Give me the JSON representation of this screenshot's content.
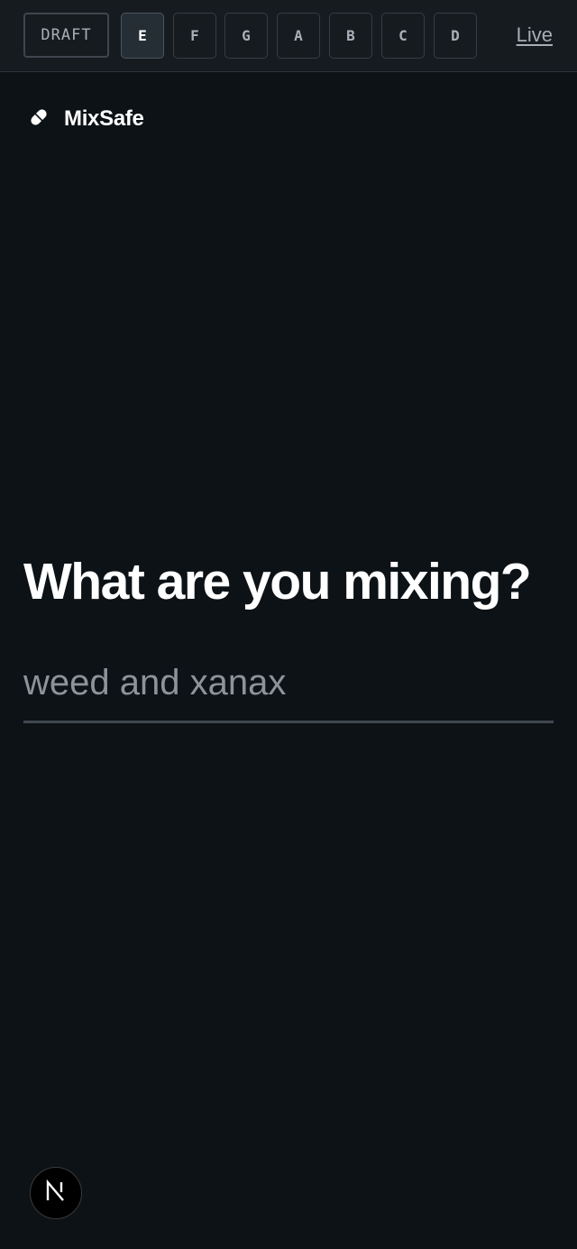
{
  "toolbar": {
    "draft_label": "DRAFT",
    "variants": [
      {
        "label": "E",
        "active": true
      },
      {
        "label": "F",
        "active": false
      },
      {
        "label": "G",
        "active": false
      },
      {
        "label": "A",
        "active": false
      },
      {
        "label": "B",
        "active": false
      },
      {
        "label": "C",
        "active": false
      },
      {
        "label": "D",
        "active": false
      }
    ],
    "live_label": "Live"
  },
  "brand": {
    "icon": "pill-icon",
    "name": "MixSafe"
  },
  "main": {
    "headline": "What are you mixing?",
    "input": {
      "value": "",
      "placeholder": "weed and xanax"
    }
  },
  "dev_badge": {
    "icon": "nextjs-icon"
  },
  "colors": {
    "background": "#0d1216",
    "topbar": "#161b20",
    "text_primary": "#ffffff",
    "text_muted": "#8c949a"
  }
}
